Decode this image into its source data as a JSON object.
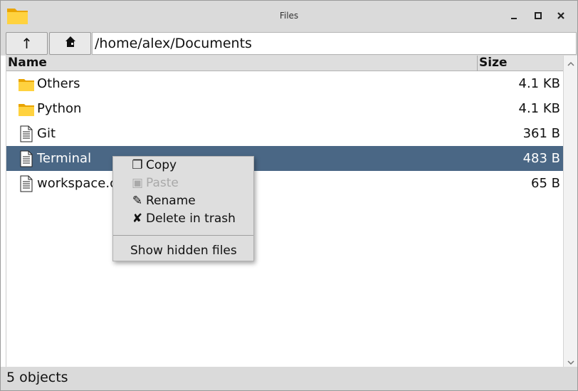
{
  "window": {
    "title": "Files",
    "icons": {
      "app": "folder-icon",
      "minimize": "minimize-icon",
      "maximize": "maximize-icon",
      "close": "close-icon"
    }
  },
  "toolbar": {
    "up_label": "↑",
    "home_icon": "home-icon",
    "path": "/home/alex/Documents"
  },
  "list": {
    "columns": {
      "name": "Name",
      "size": "Size"
    },
    "rows": [
      {
        "name": "Others",
        "size": "4.1 KB",
        "icon": "folder-icon",
        "selected": false
      },
      {
        "name": "Python",
        "size": "4.1 KB",
        "icon": "folder-icon",
        "selected": false
      },
      {
        "name": "Git",
        "size": "361 B",
        "icon": "file-icon",
        "selected": false
      },
      {
        "name": "Terminal",
        "size": "483 B",
        "icon": "file-icon",
        "selected": true
      },
      {
        "name": "workspace.c",
        "size": "65 B",
        "icon": "file-icon",
        "selected": false
      }
    ]
  },
  "context_menu": {
    "items": [
      {
        "glyph": "❐",
        "label": "Copy",
        "enabled": true
      },
      {
        "glyph": "▣",
        "label": "Paste",
        "enabled": false
      },
      {
        "glyph": "✎",
        "label": "Rename",
        "enabled": true
      },
      {
        "glyph": "✘",
        "label": "Delete in trash",
        "enabled": true
      }
    ],
    "extra": {
      "label": "Show hidden files"
    }
  },
  "status": {
    "text": "5 objects"
  },
  "colors": {
    "selection": "#4a6785",
    "folder": "#f6b90f",
    "chrome": "#dadada"
  }
}
